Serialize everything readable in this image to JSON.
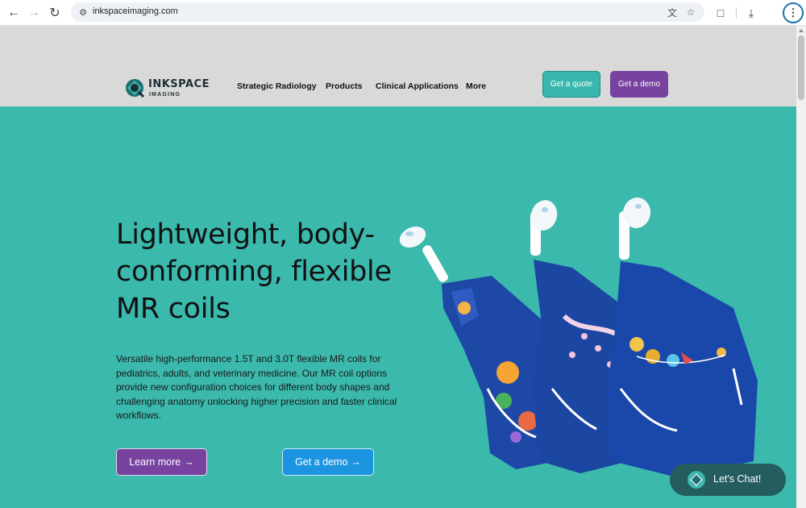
{
  "browser": {
    "url": "inkspaceimaging.com",
    "icons": [
      "back-icon",
      "forward-icon",
      "reload-icon",
      "site-info-icon",
      "translate-icon",
      "bookmark-star-icon",
      "extensions-icon",
      "download-icon",
      "menu-icon"
    ]
  },
  "header": {
    "logo_word": "INKSPACE",
    "logo_sub": "IMAGING",
    "nav": [
      {
        "label": "Strategic Radiology"
      },
      {
        "label": "Products"
      },
      {
        "label": "Clinical Applications"
      },
      {
        "label": "More"
      }
    ],
    "quote_label": "Get a quote",
    "demo_label": "Get a demo"
  },
  "hero": {
    "headline": "Lightweight, body-conforming, flexible MR coils",
    "body": "Versatile high-performance 1.5T and 3.0T flexible MR coils for pediatrics, adults, and veterinary medicine. Our MR coil options provide new configuration choices for different body shapes and challenging anatomy unlocking higher precision and faster clinical workflows.",
    "learn_more_label": "Learn more",
    "demo_label": "Get a demo",
    "arrow": "→"
  },
  "chat": {
    "label": "Let's Chat!"
  },
  "colors": {
    "teal": "#3ab9ac",
    "purple": "#7742a0",
    "blue": "#1d94e0",
    "header_bg": "#d9d9d9",
    "chat_bg": "#245d5e"
  }
}
